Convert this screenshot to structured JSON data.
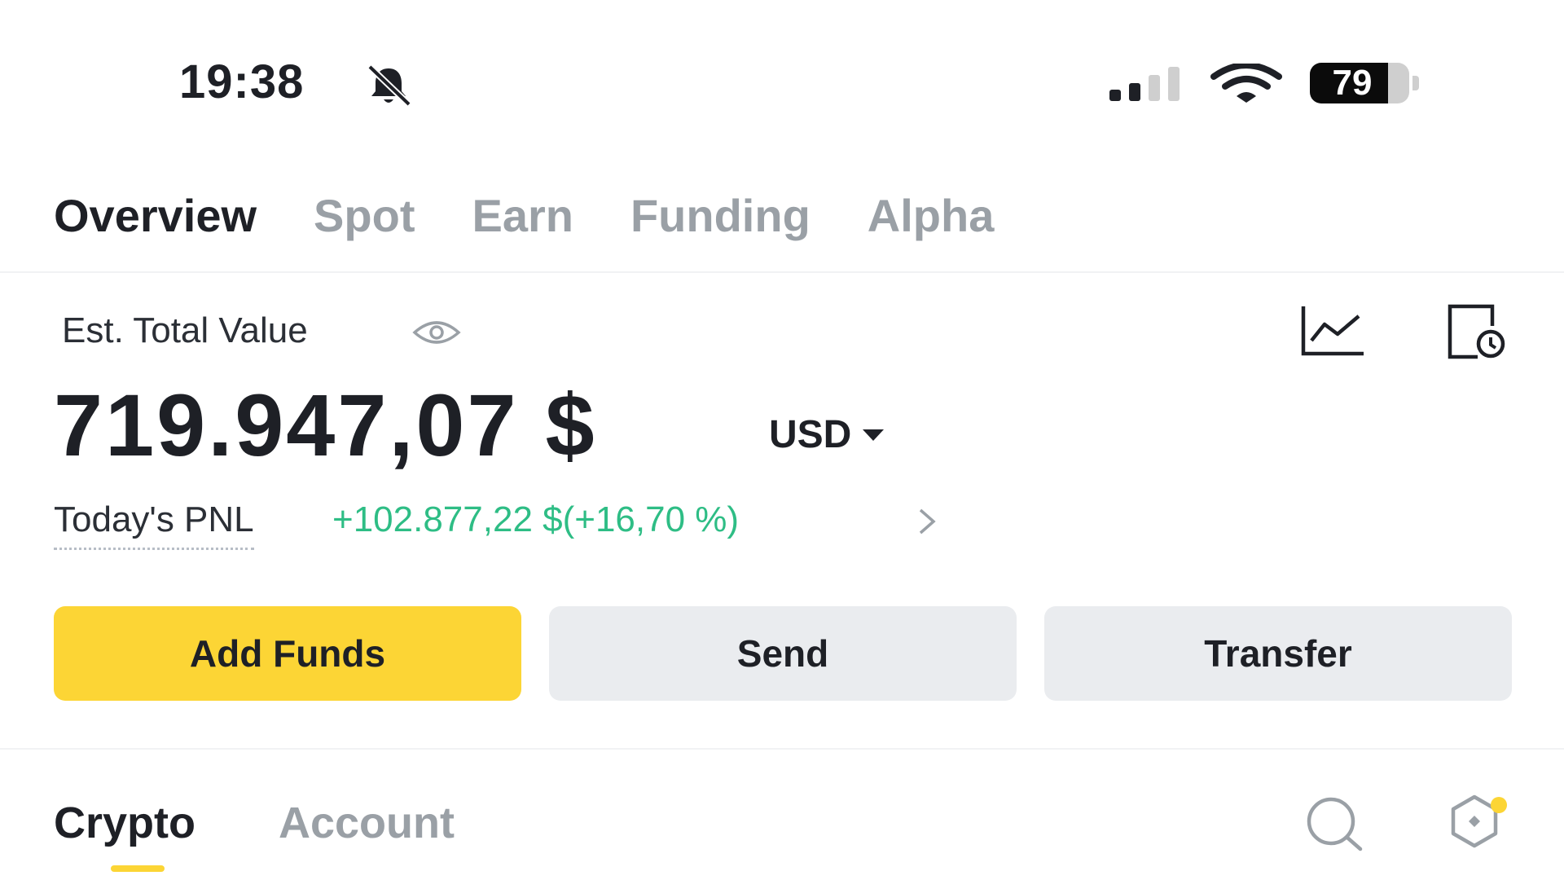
{
  "status_bar": {
    "time": "19:38",
    "battery_level": "79",
    "battery_fraction": 0.79,
    "icons": [
      "bell-muted-icon",
      "cellular-signal-icon",
      "wifi-icon",
      "battery-icon"
    ]
  },
  "top_tabs": [
    {
      "label": "Overview",
      "active": true
    },
    {
      "label": "Spot",
      "active": false
    },
    {
      "label": "Earn",
      "active": false
    },
    {
      "label": "Funding",
      "active": false
    },
    {
      "label": "Alpha",
      "active": false
    }
  ],
  "overview": {
    "total_label": "Est. Total Value",
    "total_value": "719.947,07 $",
    "currency": "USD",
    "pnl_label": "Today's PNL",
    "pnl_value": "+102.877,22 $(+16,70 %)",
    "icons": [
      "eye-icon",
      "chart-icon",
      "history-icon",
      "caret-down-icon",
      "chevron-right-icon"
    ]
  },
  "actions": {
    "add_funds": "Add Funds",
    "send": "Send",
    "transfer": "Transfer"
  },
  "bottom_tabs": [
    {
      "label": "Crypto",
      "active": true
    },
    {
      "label": "Account",
      "active": false
    }
  ],
  "bottom_icons": [
    "search-icon",
    "settings-hex-icon"
  ],
  "colors": {
    "accent_yellow": "#fcd535",
    "positive_green": "#2ebd85",
    "text_primary": "#1e2026",
    "text_muted": "#9aa0a6",
    "button_grey": "#eaecef"
  }
}
